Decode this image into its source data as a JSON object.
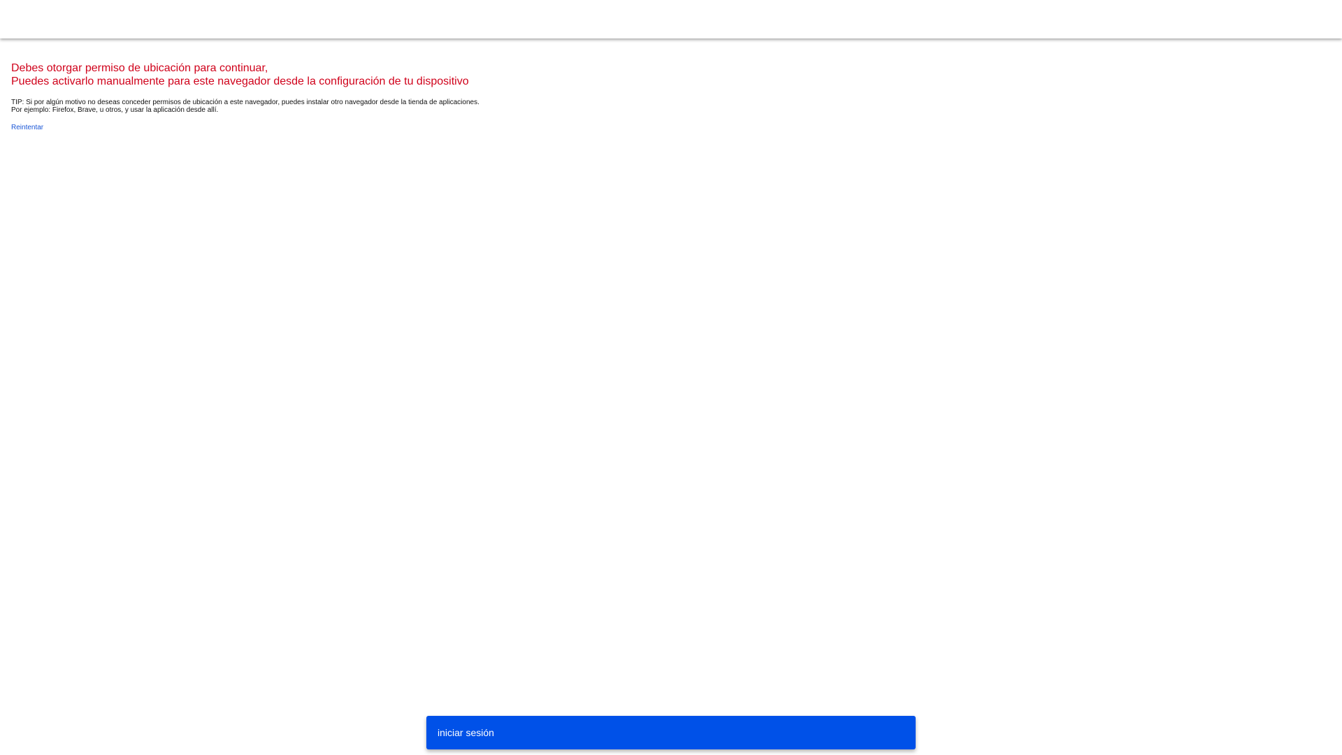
{
  "colors": {
    "error": "#d0021b",
    "link": "#1a56d6",
    "snackbar_bg": "#0051e8",
    "snackbar_text": "#ffffff"
  },
  "message": {
    "line1": "Debes otorgar permiso de ubicación para continuar,",
    "line2": "Puedes activarlo manualmente para este navegador desde la configuración de tu dispositivo"
  },
  "tip": {
    "line1": "TIP: Si por algún motivo no deseas conceder permisos de ubicación a este navegador, puedes instalar otro navegador desde la tienda de aplicaciones.",
    "line2": "Por ejemplo: Firefox, Brave, u otros, y usar la aplicación desde allí."
  },
  "retry_label": "Reintentar",
  "snackbar": {
    "label": "iniciar sesión"
  }
}
